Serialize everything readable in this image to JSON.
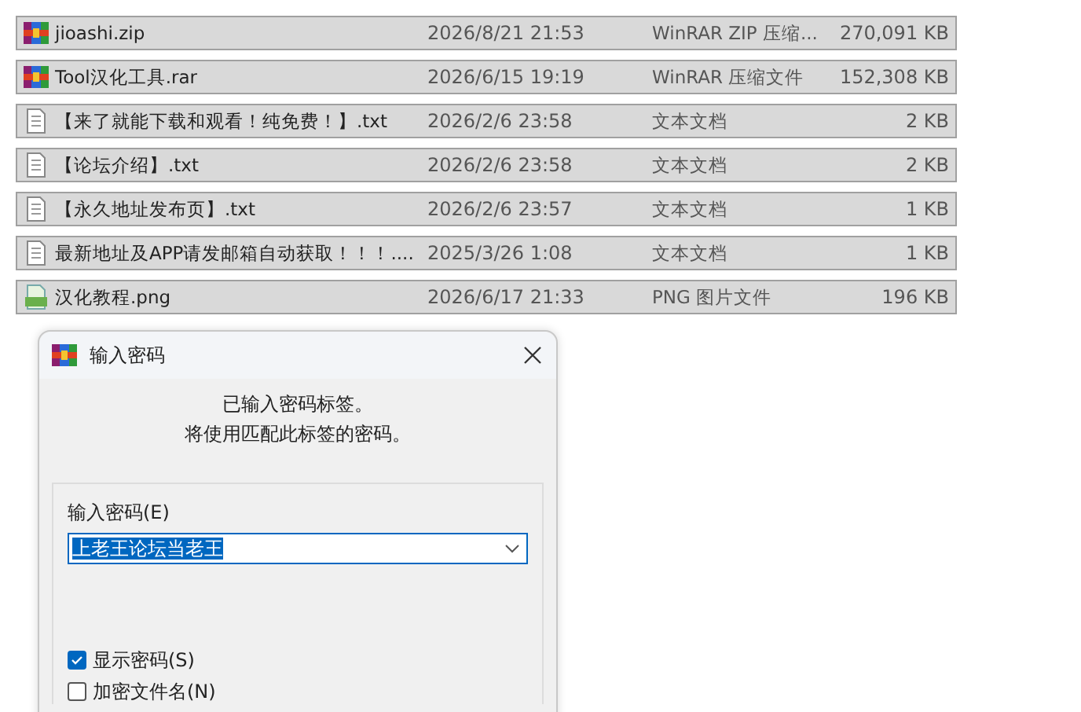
{
  "files": [
    {
      "kind": "archive",
      "name": "jioashi.zip",
      "date": "2026/8/21 21:53",
      "type": "WinRAR ZIP 压缩...",
      "size": "270,091 KB"
    },
    {
      "kind": "archive",
      "name": "Tool汉化工具.rar",
      "date": "2026/6/15 19:19",
      "type": "WinRAR 压缩文件",
      "size": "152,308 KB"
    },
    {
      "kind": "text",
      "name": "【来了就能下载和观看！纯免费！】.txt",
      "date": "2026/2/6 23:58",
      "type": "文本文档",
      "size": "2 KB"
    },
    {
      "kind": "text",
      "name": "【论坛介绍】.txt",
      "date": "2026/2/6 23:58",
      "type": "文本文档",
      "size": "2 KB"
    },
    {
      "kind": "text",
      "name": "【永久地址发布页】.txt",
      "date": "2026/2/6 23:57",
      "type": "文本文档",
      "size": "1 KB"
    },
    {
      "kind": "text",
      "name": "最新地址及APP请发邮箱自动获取！！！....",
      "date": "2025/3/26 1:08",
      "type": "文本文档",
      "size": "1 KB"
    },
    {
      "kind": "image",
      "name": "汉化教程.png",
      "date": "2026/6/17 21:33",
      "type": "PNG 图片文件",
      "size": "196 KB"
    }
  ],
  "dialog": {
    "title": "输入密码",
    "message": [
      "已输入密码标签。",
      "将使用匹配此标签的密码。"
    ],
    "password_label": "输入密码(E)",
    "password": {
      "value": "上老王论坛当老王",
      "text_selected": true
    },
    "options": [
      {
        "label": "显示密码(S)",
        "checked": true
      },
      {
        "label": "加密文件名(N)",
        "checked": false
      }
    ]
  }
}
